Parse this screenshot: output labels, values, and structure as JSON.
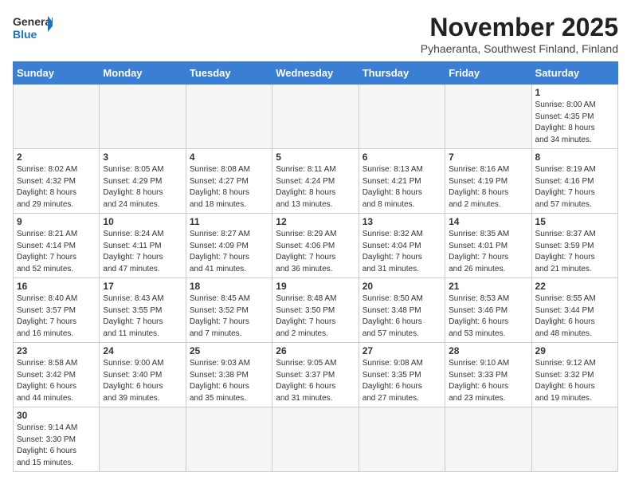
{
  "header": {
    "logo_general": "General",
    "logo_blue": "Blue",
    "month_title": "November 2025",
    "location": "Pyhaeranta, Southwest Finland, Finland"
  },
  "days_of_week": [
    "Sunday",
    "Monday",
    "Tuesday",
    "Wednesday",
    "Thursday",
    "Friday",
    "Saturday"
  ],
  "weeks": [
    [
      {
        "day": "",
        "info": ""
      },
      {
        "day": "",
        "info": ""
      },
      {
        "day": "",
        "info": ""
      },
      {
        "day": "",
        "info": ""
      },
      {
        "day": "",
        "info": ""
      },
      {
        "day": "",
        "info": ""
      },
      {
        "day": "1",
        "info": "Sunrise: 8:00 AM\nSunset: 4:35 PM\nDaylight: 8 hours\nand 34 minutes."
      }
    ],
    [
      {
        "day": "2",
        "info": "Sunrise: 8:02 AM\nSunset: 4:32 PM\nDaylight: 8 hours\nand 29 minutes."
      },
      {
        "day": "3",
        "info": "Sunrise: 8:05 AM\nSunset: 4:29 PM\nDaylight: 8 hours\nand 24 minutes."
      },
      {
        "day": "4",
        "info": "Sunrise: 8:08 AM\nSunset: 4:27 PM\nDaylight: 8 hours\nand 18 minutes."
      },
      {
        "day": "5",
        "info": "Sunrise: 8:11 AM\nSunset: 4:24 PM\nDaylight: 8 hours\nand 13 minutes."
      },
      {
        "day": "6",
        "info": "Sunrise: 8:13 AM\nSunset: 4:21 PM\nDaylight: 8 hours\nand 8 minutes."
      },
      {
        "day": "7",
        "info": "Sunrise: 8:16 AM\nSunset: 4:19 PM\nDaylight: 8 hours\nand 2 minutes."
      },
      {
        "day": "8",
        "info": "Sunrise: 8:19 AM\nSunset: 4:16 PM\nDaylight: 7 hours\nand 57 minutes."
      }
    ],
    [
      {
        "day": "9",
        "info": "Sunrise: 8:21 AM\nSunset: 4:14 PM\nDaylight: 7 hours\nand 52 minutes."
      },
      {
        "day": "10",
        "info": "Sunrise: 8:24 AM\nSunset: 4:11 PM\nDaylight: 7 hours\nand 47 minutes."
      },
      {
        "day": "11",
        "info": "Sunrise: 8:27 AM\nSunset: 4:09 PM\nDaylight: 7 hours\nand 41 minutes."
      },
      {
        "day": "12",
        "info": "Sunrise: 8:29 AM\nSunset: 4:06 PM\nDaylight: 7 hours\nand 36 minutes."
      },
      {
        "day": "13",
        "info": "Sunrise: 8:32 AM\nSunset: 4:04 PM\nDaylight: 7 hours\nand 31 minutes."
      },
      {
        "day": "14",
        "info": "Sunrise: 8:35 AM\nSunset: 4:01 PM\nDaylight: 7 hours\nand 26 minutes."
      },
      {
        "day": "15",
        "info": "Sunrise: 8:37 AM\nSunset: 3:59 PM\nDaylight: 7 hours\nand 21 minutes."
      }
    ],
    [
      {
        "day": "16",
        "info": "Sunrise: 8:40 AM\nSunset: 3:57 PM\nDaylight: 7 hours\nand 16 minutes."
      },
      {
        "day": "17",
        "info": "Sunrise: 8:43 AM\nSunset: 3:55 PM\nDaylight: 7 hours\nand 11 minutes."
      },
      {
        "day": "18",
        "info": "Sunrise: 8:45 AM\nSunset: 3:52 PM\nDaylight: 7 hours\nand 7 minutes."
      },
      {
        "day": "19",
        "info": "Sunrise: 8:48 AM\nSunset: 3:50 PM\nDaylight: 7 hours\nand 2 minutes."
      },
      {
        "day": "20",
        "info": "Sunrise: 8:50 AM\nSunset: 3:48 PM\nDaylight: 6 hours\nand 57 minutes."
      },
      {
        "day": "21",
        "info": "Sunrise: 8:53 AM\nSunset: 3:46 PM\nDaylight: 6 hours\nand 53 minutes."
      },
      {
        "day": "22",
        "info": "Sunrise: 8:55 AM\nSunset: 3:44 PM\nDaylight: 6 hours\nand 48 minutes."
      }
    ],
    [
      {
        "day": "23",
        "info": "Sunrise: 8:58 AM\nSunset: 3:42 PM\nDaylight: 6 hours\nand 44 minutes."
      },
      {
        "day": "24",
        "info": "Sunrise: 9:00 AM\nSunset: 3:40 PM\nDaylight: 6 hours\nand 39 minutes."
      },
      {
        "day": "25",
        "info": "Sunrise: 9:03 AM\nSunset: 3:38 PM\nDaylight: 6 hours\nand 35 minutes."
      },
      {
        "day": "26",
        "info": "Sunrise: 9:05 AM\nSunset: 3:37 PM\nDaylight: 6 hours\nand 31 minutes."
      },
      {
        "day": "27",
        "info": "Sunrise: 9:08 AM\nSunset: 3:35 PM\nDaylight: 6 hours\nand 27 minutes."
      },
      {
        "day": "28",
        "info": "Sunrise: 9:10 AM\nSunset: 3:33 PM\nDaylight: 6 hours\nand 23 minutes."
      },
      {
        "day": "29",
        "info": "Sunrise: 9:12 AM\nSunset: 3:32 PM\nDaylight: 6 hours\nand 19 minutes."
      }
    ],
    [
      {
        "day": "30",
        "info": "Sunrise: 9:14 AM\nSunset: 3:30 PM\nDaylight: 6 hours\nand 15 minutes."
      },
      {
        "day": "",
        "info": ""
      },
      {
        "day": "",
        "info": ""
      },
      {
        "day": "",
        "info": ""
      },
      {
        "day": "",
        "info": ""
      },
      {
        "day": "",
        "info": ""
      },
      {
        "day": "",
        "info": ""
      }
    ]
  ]
}
